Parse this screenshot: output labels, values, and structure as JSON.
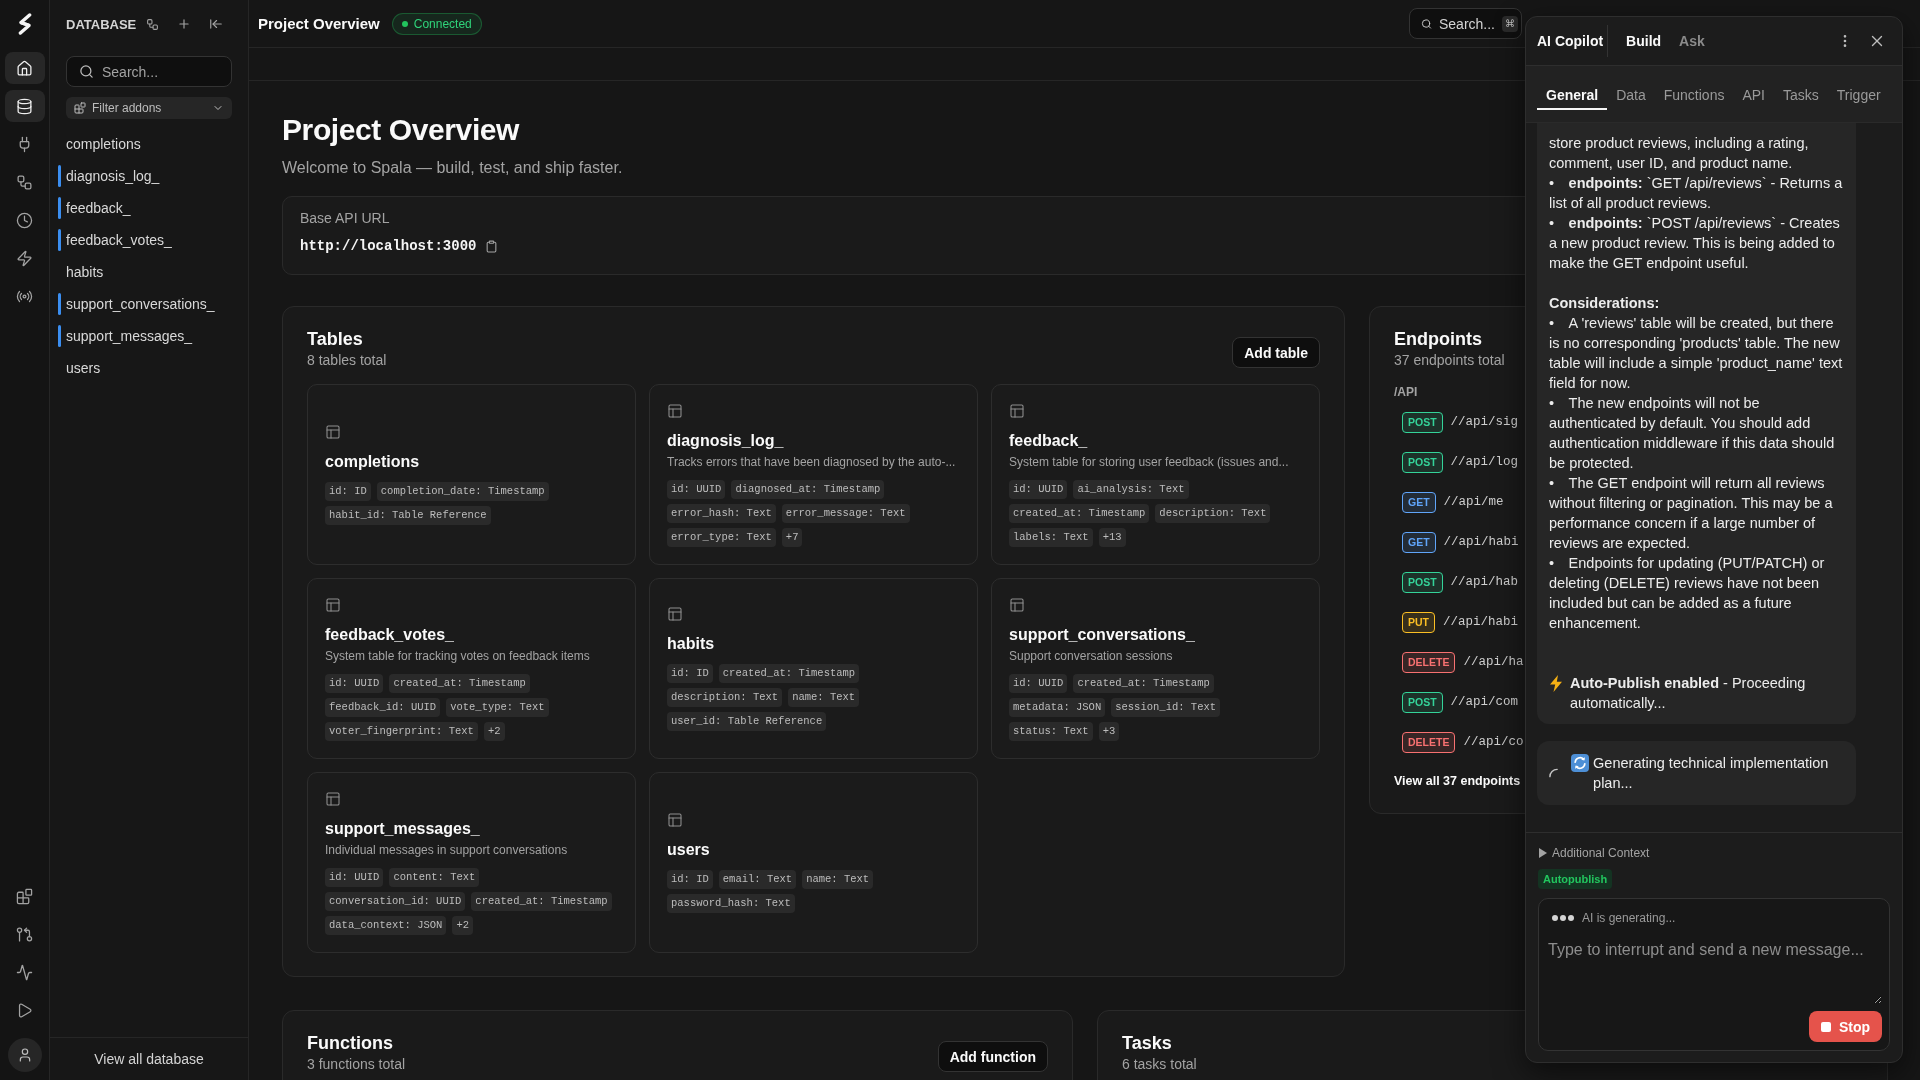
{
  "rail": {
    "nav": [
      {
        "kind": "home",
        "selected": true
      },
      {
        "kind": "database",
        "selected": true
      },
      {
        "kind": "plug",
        "selected": false
      },
      {
        "kind": "workflow",
        "selected": false
      },
      {
        "kind": "history",
        "selected": false
      },
      {
        "kind": "zap",
        "selected": false
      },
      {
        "kind": "radio",
        "selected": false
      }
    ],
    "tools": [
      {
        "kind": "blocks"
      },
      {
        "kind": "branch"
      },
      {
        "kind": "activity"
      },
      {
        "kind": "play"
      }
    ]
  },
  "sidebar": {
    "title": "DATABASE",
    "search": {
      "placeholder": "Search..."
    },
    "filter": "Filter addons",
    "tables": [
      {
        "name": "completions",
        "accent_bar": false
      },
      {
        "name": "diagnosis_log_",
        "accent_bar": true
      },
      {
        "name": "feedback_",
        "accent_bar": true
      },
      {
        "name": "feedback_votes_",
        "accent_bar": true
      },
      {
        "name": "habits",
        "accent_bar": false
      },
      {
        "name": "support_conversations_",
        "accent_bar": true
      },
      {
        "name": "support_messages_",
        "accent_bar": true
      },
      {
        "name": "users",
        "accent_bar": false
      }
    ],
    "footer_link": "View all database"
  },
  "topbar": {
    "title": "Project Overview",
    "status": "Connected",
    "search": {
      "label": "Search...",
      "shortcut": "⌘"
    }
  },
  "overview": {
    "title": "Project Overview",
    "subtitle": "Welcome to Spala — build, test, and ship faster.",
    "api": {
      "label": "Base API URL",
      "url": "http://localhost:3000"
    }
  },
  "tables": {
    "title": "Tables",
    "count": "8 tables total",
    "button": "Add table",
    "items": [
      {
        "name": "completions",
        "fields": [
          "id: ID",
          "completion_date: Timestamp",
          "habit_id: Table Reference"
        ]
      },
      {
        "name": "diagnosis_log_",
        "description": "Tracks errors that have been diagnosed by the auto-...",
        "fields": [
          "id: UUID",
          "diagnosed_at: Timestamp",
          "error_hash: Text",
          "error_message: Text",
          "error_type: Text"
        ],
        "more": "+7"
      },
      {
        "name": "feedback_",
        "description": "System table for storing user feedback (issues and...",
        "fields": [
          "id: UUID",
          "ai_analysis: Text",
          "created_at: Timestamp",
          "description: Text",
          "labels: Text"
        ],
        "more": "+13"
      },
      {
        "name": "feedback_votes_",
        "description": "System table for tracking votes on feedback items",
        "fields": [
          "id: UUID",
          "created_at: Timestamp",
          "feedback_id: UUID",
          "vote_type: Text",
          "voter_fingerprint: Text"
        ],
        "more": "+2"
      },
      {
        "name": "habits",
        "fields": [
          "id: ID",
          "created_at: Timestamp",
          "description: Text",
          "name: Text",
          "user_id: Table Reference"
        ]
      },
      {
        "name": "support_conversations_",
        "description": "Support conversation sessions",
        "fields": [
          "id: UUID",
          "created_at: Timestamp",
          "metadata: JSON",
          "session_id: Text",
          "status: Text"
        ],
        "more": "+3"
      },
      {
        "name": "support_messages_",
        "description": "Individual messages in support conversations",
        "fields": [
          "id: UUID",
          "content: Text",
          "conversation_id: UUID",
          "created_at: Timestamp",
          "data_context: JSON"
        ],
        "more": "+2"
      },
      {
        "name": "users",
        "fields": [
          "id: ID",
          "email: Text",
          "name: Text",
          "password_hash: Text"
        ]
      }
    ]
  },
  "endpoints": {
    "title": "Endpoints",
    "count": "37 endpoints total",
    "group": "/API",
    "items": [
      {
        "method": "POST",
        "path": "//api/sig",
        "color": "#34d399"
      },
      {
        "method": "POST",
        "path": "//api/log",
        "color": "#34d399"
      },
      {
        "method": "GET",
        "path": "//api/me",
        "color": "#60a5fa"
      },
      {
        "method": "GET",
        "path": "//api/habi",
        "color": "#60a5fa"
      },
      {
        "method": "POST",
        "path": "//api/hab",
        "color": "#34d399"
      },
      {
        "method": "PUT",
        "path": "//api/habi",
        "color": "#fbbf24"
      },
      {
        "method": "DELETE",
        "path": "//api/ha",
        "color": "#f87171"
      },
      {
        "method": "POST",
        "path": "//api/com",
        "color": "#34d399"
      },
      {
        "method": "DELETE",
        "path": "//api/co",
        "color": "#f87171"
      }
    ],
    "link": "View all 37 endpoints"
  },
  "functions": {
    "title": "Functions",
    "count": "3 functions total",
    "button": "Add function"
  },
  "tasks": {
    "title": "Tasks",
    "count": "6 tasks total"
  },
  "copilot": {
    "title": "AI Copilot",
    "modes": [
      {
        "label": "Build",
        "selected": true
      },
      {
        "label": "Ask",
        "selected": false
      }
    ],
    "tabs": [
      {
        "label": "General",
        "selected": true
      },
      {
        "label": "Data",
        "selected": false
      },
      {
        "label": "Functions",
        "selected": false
      },
      {
        "label": "API",
        "selected": false
      },
      {
        "label": "Tasks",
        "selected": false
      },
      {
        "label": "Trigger",
        "selected": false
      }
    ],
    "messages": [
      {
        "kind": "response",
        "blocks": [
          {
            "kind": "text",
            "text": "store product reviews, including a rating, comment, user ID, and product name."
          },
          {
            "kind": "text",
            "text": "• **endpoints:** `GET /api/reviews` - Returns a list of all product reviews."
          },
          {
            "kind": "text",
            "text": "• **endpoints:** `POST /api/reviews` - Creates a new product review. This is being added to make the GET endpoint useful."
          },
          {
            "kind": "heading",
            "text": "Considerations:"
          },
          {
            "kind": "text",
            "text": "• A 'reviews' table will be created, but there is no corresponding 'products' table. The new table will include a simple 'product_name' text field for now."
          },
          {
            "kind": "text",
            "text": "• The new endpoints will not be authenticated by default. You should add authentication middleware if this data should be protected."
          },
          {
            "kind": "text",
            "text": "• The GET endpoint will return all reviews without filtering or pagination. This may be a performance concern if a large number of reviews are expected."
          },
          {
            "kind": "text",
            "text": "• Endpoints for updating (PUT/PATCH) or deleting (DELETE) reviews have not been included but can be added as a future enhancement."
          },
          {
            "kind": "notice",
            "text": "**Auto-Publish enabled** - Proceeding automatically..."
          }
        ]
      },
      {
        "kind": "progress",
        "text": "Generating technical implementation plan..."
      }
    ],
    "context_toggle": {
      "label": "Additional Context",
      "expanded": false
    },
    "tag": "Autopublish",
    "composer": {
      "status": "AI is generating...",
      "placeholder": "Type to interrupt and send a new message...",
      "button": "Stop"
    }
  }
}
